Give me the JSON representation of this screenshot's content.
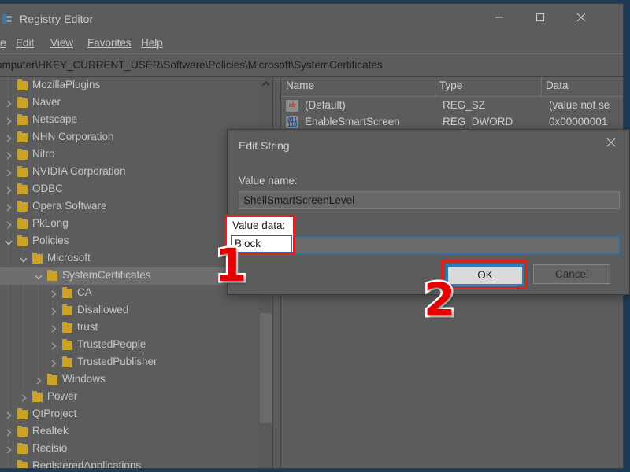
{
  "desktop": {
    "background": "#1d3b55"
  },
  "window": {
    "title": "Registry Editor",
    "icon": "registry-editor-icon",
    "controls": {
      "minimize": "minimize-icon",
      "maximize": "maximize-icon",
      "close": "close-icon"
    },
    "menu": [
      {
        "label": "e",
        "accel": ""
      },
      {
        "label": "Edit",
        "accel": "E"
      },
      {
        "label": "View",
        "accel": "V"
      },
      {
        "label": "Favorites",
        "accel": "a"
      },
      {
        "label": "Help",
        "accel": "H"
      }
    ],
    "address": "omputer\\HKEY_CURRENT_USER\\Software\\Policies\\Microsoft\\SystemCertificates"
  },
  "tree": {
    "scroll_up_icon": "chevron-up-icon",
    "scroll_down_icon": "chevron-down-icon",
    "nodes": [
      {
        "label": "MozillaPlugins",
        "indent": 1,
        "state": "leaf",
        "selected": false
      },
      {
        "label": "Naver",
        "indent": 1,
        "state": "collapsed",
        "selected": false
      },
      {
        "label": "Netscape",
        "indent": 1,
        "state": "collapsed",
        "selected": false
      },
      {
        "label": "NHN Corporation",
        "indent": 1,
        "state": "collapsed",
        "selected": false
      },
      {
        "label": "Nitro",
        "indent": 1,
        "state": "collapsed",
        "selected": false
      },
      {
        "label": "NVIDIA Corporation",
        "indent": 1,
        "state": "collapsed",
        "selected": false
      },
      {
        "label": "ODBC",
        "indent": 1,
        "state": "collapsed",
        "selected": false
      },
      {
        "label": "Opera Software",
        "indent": 1,
        "state": "collapsed",
        "selected": false
      },
      {
        "label": "PkLong",
        "indent": 1,
        "state": "collapsed",
        "selected": false
      },
      {
        "label": "Policies",
        "indent": 1,
        "state": "expanded",
        "selected": false
      },
      {
        "label": "Microsoft",
        "indent": 2,
        "state": "expanded",
        "selected": false
      },
      {
        "label": "SystemCertificates",
        "indent": 3,
        "state": "expanded",
        "selected": true
      },
      {
        "label": "CA",
        "indent": 4,
        "state": "collapsed",
        "selected": false
      },
      {
        "label": "Disallowed",
        "indent": 4,
        "state": "collapsed",
        "selected": false
      },
      {
        "label": "trust",
        "indent": 4,
        "state": "collapsed",
        "selected": false
      },
      {
        "label": "TrustedPeople",
        "indent": 4,
        "state": "collapsed",
        "selected": false
      },
      {
        "label": "TrustedPublisher",
        "indent": 4,
        "state": "collapsed",
        "selected": false
      },
      {
        "label": "Windows",
        "indent": 3,
        "state": "collapsed",
        "selected": false
      },
      {
        "label": "Power",
        "indent": 2,
        "state": "collapsed",
        "selected": false
      },
      {
        "label": "QtProject",
        "indent": 1,
        "state": "collapsed",
        "selected": false
      },
      {
        "label": "Realtek",
        "indent": 1,
        "state": "collapsed",
        "selected": false
      },
      {
        "label": "Recisio",
        "indent": 1,
        "state": "collapsed",
        "selected": false
      },
      {
        "label": "RegisteredApplications",
        "indent": 1,
        "state": "leaf",
        "selected": false
      }
    ]
  },
  "list": {
    "columns": [
      "Name",
      "Type",
      "Data"
    ],
    "rows": [
      {
        "icon": "reg-sz-icon",
        "name": "(Default)",
        "type": "REG_SZ",
        "data": "(value not se"
      },
      {
        "icon": "reg-dword-icon",
        "name": "EnableSmartScreen",
        "type": "REG_DWORD",
        "data": "0x00000001"
      }
    ]
  },
  "dialog": {
    "title": "Edit String",
    "close_icon": "close-icon",
    "value_name_label": "Value name:",
    "value_name": "ShellSmartScreenLevel",
    "value_data_label": "Value data:",
    "value_data": "Block",
    "ok_label": "OK",
    "cancel_label": "Cancel"
  },
  "annotations": {
    "marker_1": "1",
    "marker_2": "2",
    "color": "#e60000",
    "value_data_label": "Value data:",
    "value_data": "Block",
    "ok_label": "OK"
  }
}
